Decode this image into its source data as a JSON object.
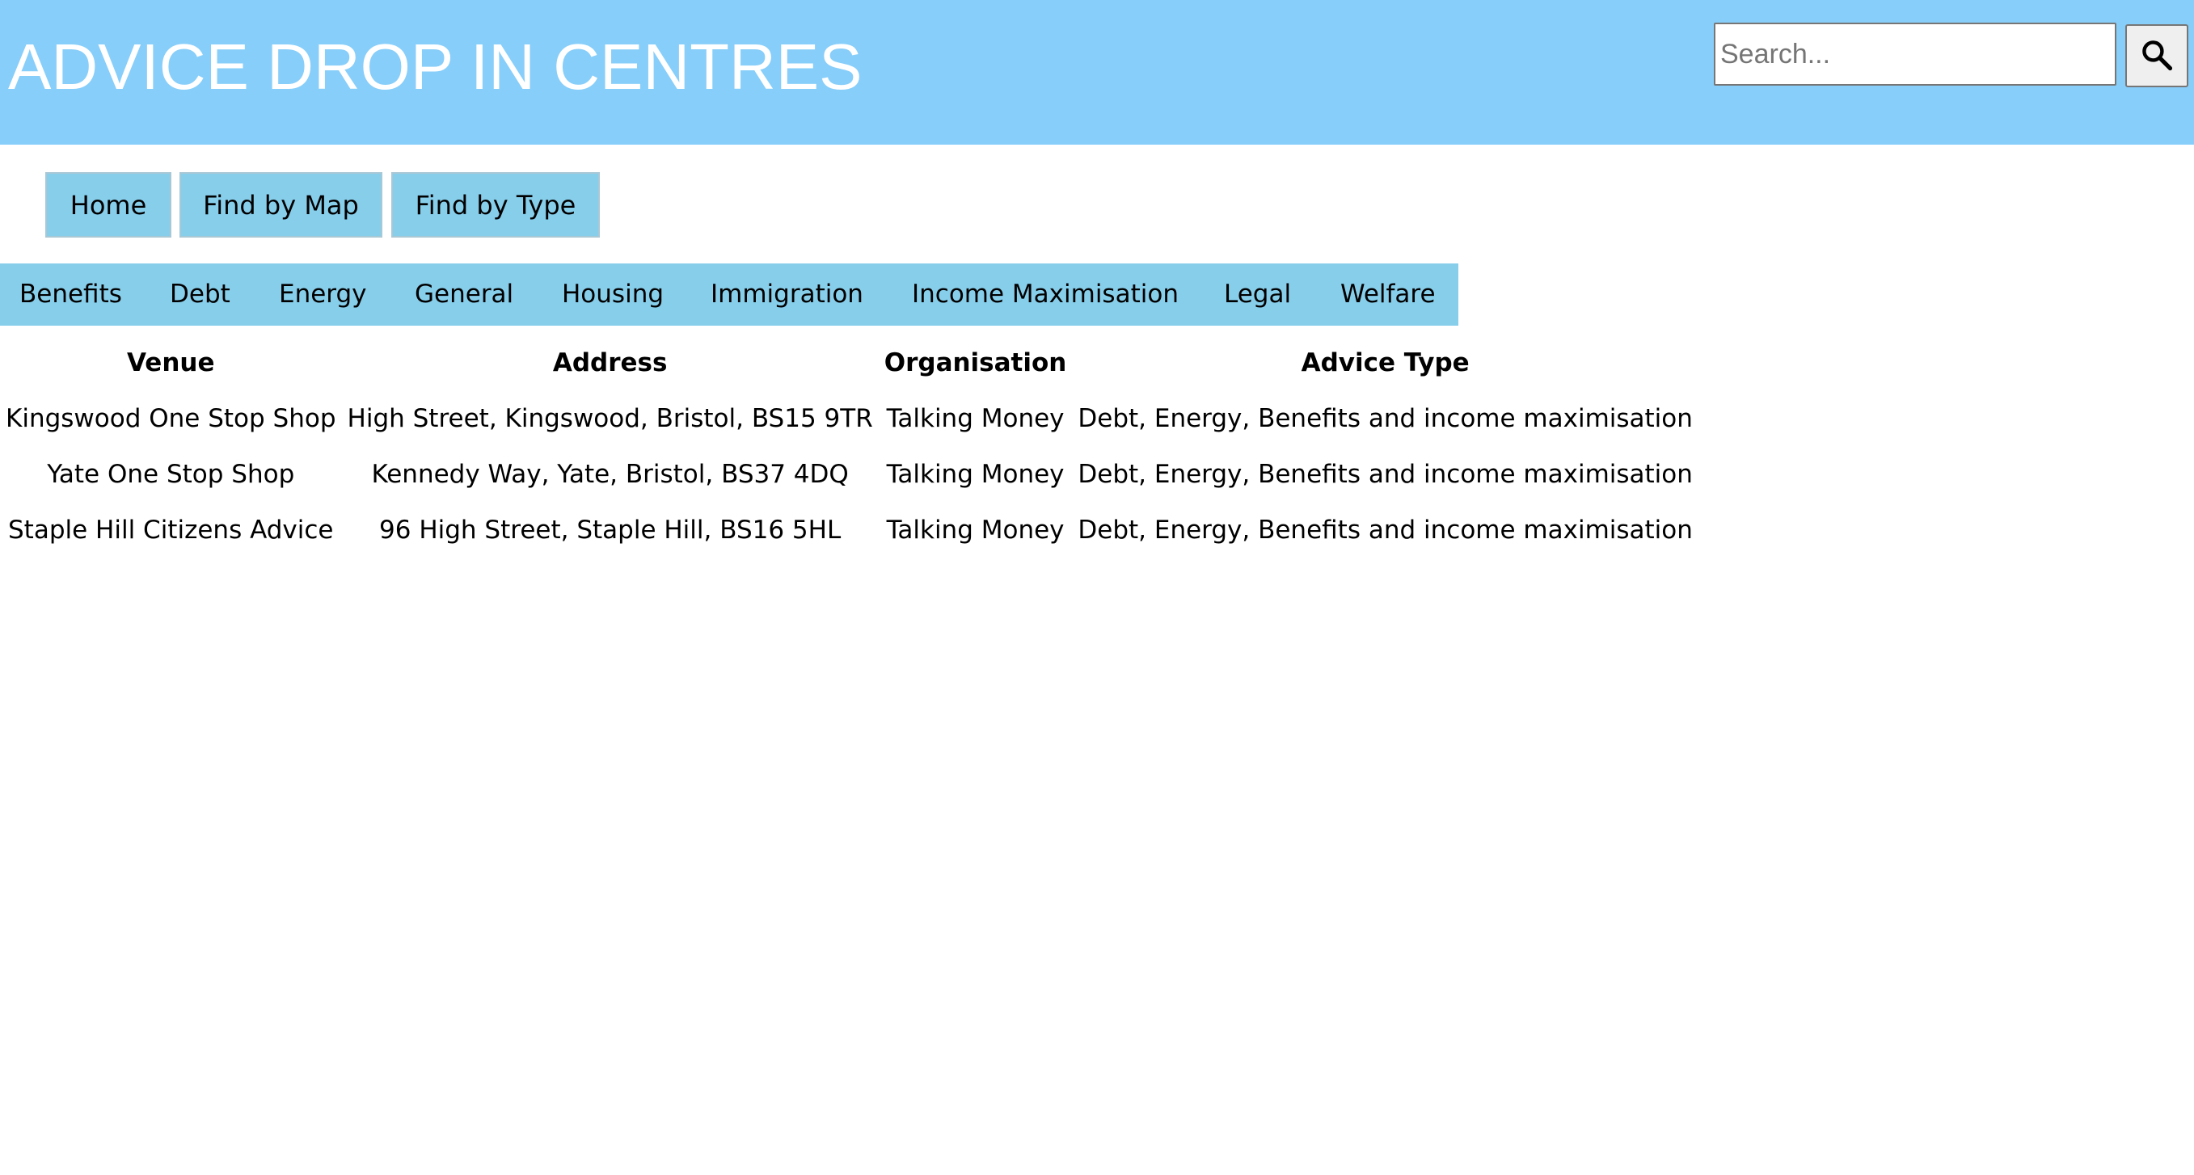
{
  "header": {
    "title": "ADVICE DROP IN CENTRES",
    "search_placeholder": "Search...",
    "search_button_icon": "search-icon",
    "background_color": "#87cefa"
  },
  "nav": {
    "buttons": [
      {
        "label": "Home"
      },
      {
        "label": "Find by Map"
      },
      {
        "label": "Find by Type"
      }
    ],
    "button_color": "#87ceeb"
  },
  "advice_types": [
    {
      "label": "Benefits"
    },
    {
      "label": "Debt"
    },
    {
      "label": "Energy"
    },
    {
      "label": "General"
    },
    {
      "label": "Housing"
    },
    {
      "label": "Immigration"
    },
    {
      "label": "Income Maximisation"
    },
    {
      "label": "Legal"
    },
    {
      "label": "Welfare"
    }
  ],
  "table": {
    "headers": [
      "Venue",
      "Address",
      "Organisation",
      "Advice Type"
    ],
    "rows": [
      [
        "Kingswood One Stop Shop",
        "High Street, Kingswood, Bristol, BS15 9TR",
        "Talking Money",
        "Debt, Energy, Benefits and income maximisation"
      ],
      [
        "Yate One Stop Shop",
        "Kennedy Way, Yate, Bristol, BS37 4DQ",
        "Talking Money",
        "Debt, Energy, Benefits and income maximisation"
      ],
      [
        "Staple Hill Citizens Advice",
        "96 High Street, Staple Hill, BS16 5HL",
        "Talking Money",
        "Debt, Energy, Benefits and income maximisation"
      ]
    ]
  }
}
